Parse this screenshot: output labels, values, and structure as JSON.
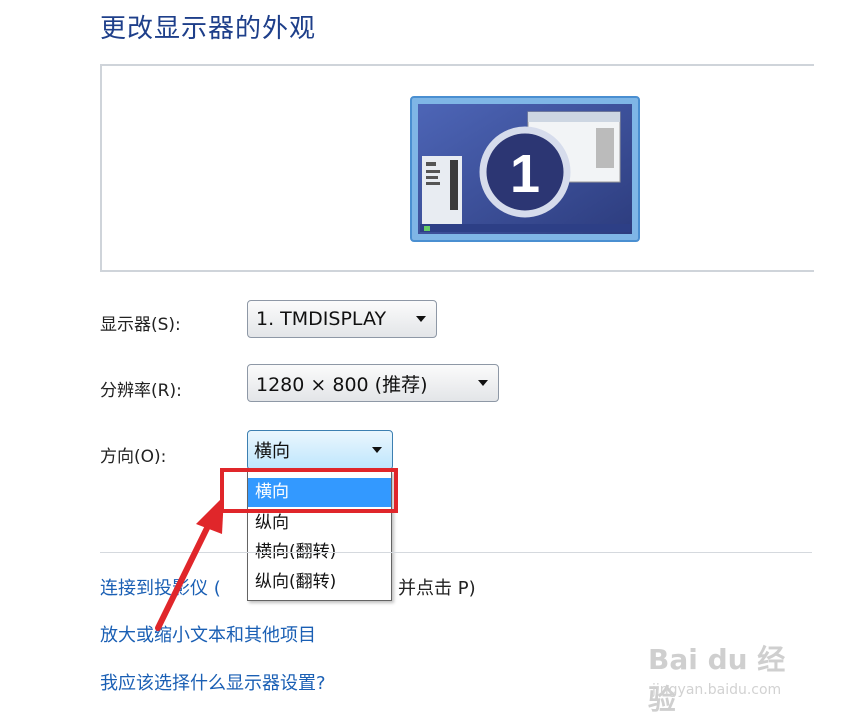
{
  "header": {
    "title": "更改显示器的外观"
  },
  "preview": {
    "monitor_number": "1"
  },
  "fields": {
    "display": {
      "label": "显示器(S):",
      "value": "1. TMDISPLAY"
    },
    "resolution": {
      "label": "分辨率(R):",
      "value": "1280 × 800 (推荐)"
    },
    "orientation": {
      "label": "方向(O):",
      "value": "横向",
      "options": [
        "横向",
        "纵向",
        "横向(翻转)",
        "纵向(翻转)"
      ],
      "highlighted_option": "横向"
    }
  },
  "links": {
    "projector": "连接到投影仪 (",
    "projector_tail": "并点击 P)",
    "text_size": "放大或缩小文本和其他项目",
    "which_settings": "我应该选择什么显示器设置?"
  },
  "watermark": {
    "brand": "Bai du 经验",
    "url": "jingyan.baidu.com"
  },
  "colors": {
    "accent_red": "#e0262a",
    "link_blue": "#1a5fb4",
    "title_blue": "#1e3f8a",
    "selection_blue": "#3399ff"
  }
}
